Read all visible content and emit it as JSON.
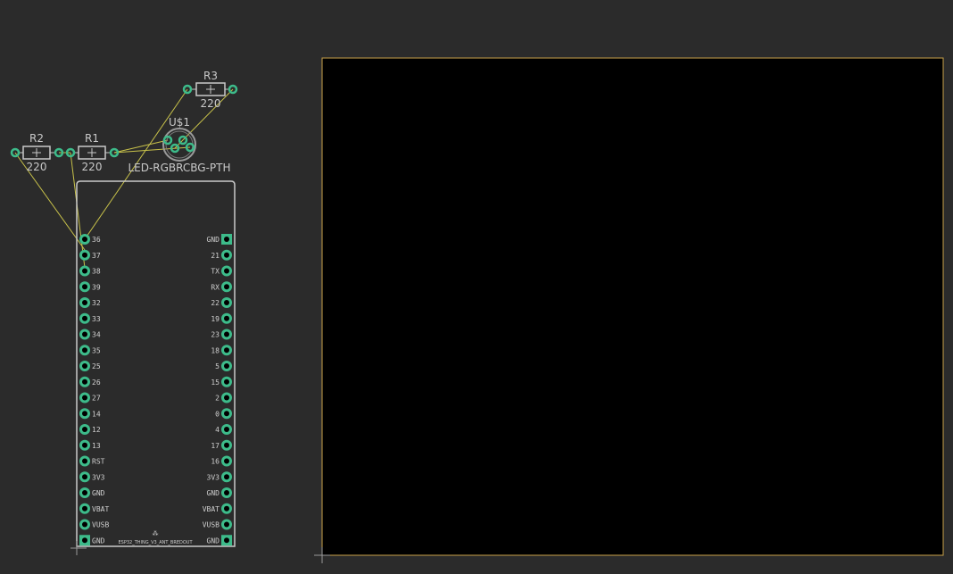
{
  "colors": {
    "background": "#2b2b2b",
    "board_fill": "#000000",
    "board_outline": "#c8a24a",
    "pad": "#3dbb8a",
    "silkscreen": "#c9c9c9",
    "airwire": "#c8c24a"
  },
  "components": {
    "r1": {
      "name": "R1",
      "value": "220"
    },
    "r2": {
      "name": "R2",
      "value": "220"
    },
    "r3": {
      "name": "R3",
      "value": "220"
    },
    "led": {
      "name": "U$1",
      "value": "LED-RGBRCBG-PTH"
    },
    "esp32": {
      "footer": "ESP32_THING_V3_ANT_BREDOUT",
      "left_pins": [
        "36",
        "37",
        "38",
        "39",
        "32",
        "33",
        "34",
        "35",
        "25",
        "26",
        "27",
        "14",
        "12",
        "13",
        "RST",
        "3V3",
        "GND",
        "VBAT",
        "VUSB",
        "GND"
      ],
      "right_pins": [
        "GND",
        "21",
        "TX",
        "RX",
        "22",
        "19",
        "23",
        "18",
        "5",
        "15",
        "2",
        "0",
        "4",
        "17",
        "16",
        "3V3",
        "GND",
        "VBAT",
        "VUSB",
        "GND"
      ]
    }
  }
}
